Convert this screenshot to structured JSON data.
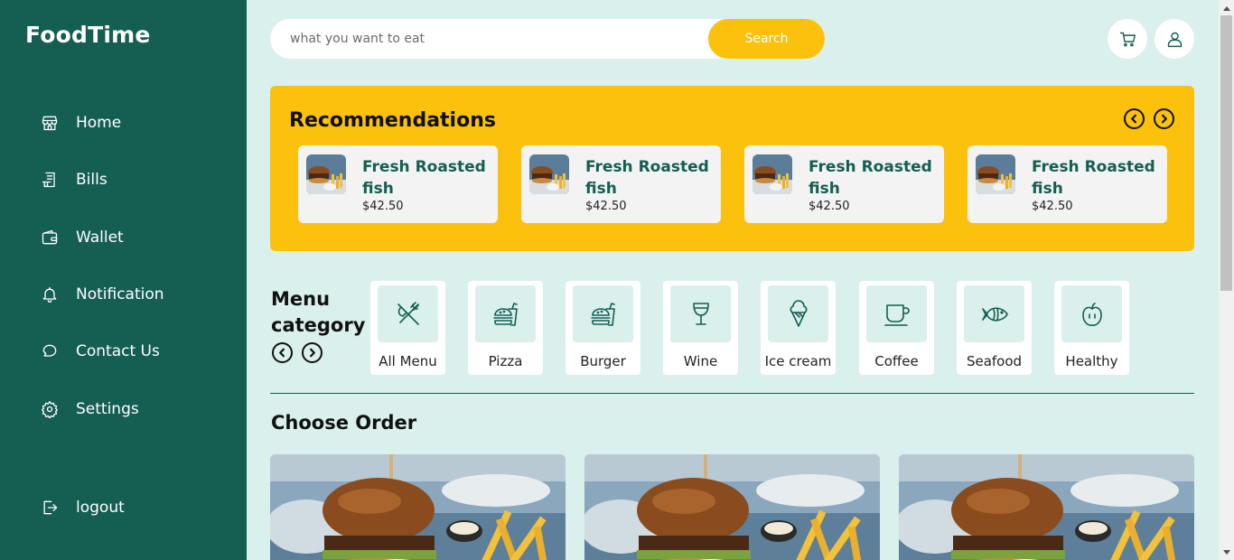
{
  "app": {
    "brand": "FoodTime"
  },
  "sidebar": {
    "items": [
      {
        "label": "Home",
        "icon": "store-icon"
      },
      {
        "label": "Bills",
        "icon": "receipt-icon"
      },
      {
        "label": "Wallet",
        "icon": "wallet-icon"
      },
      {
        "label": "Notification",
        "icon": "bell-icon"
      },
      {
        "label": "Contact Us",
        "icon": "chat-icon"
      },
      {
        "label": "Settings",
        "icon": "gear-icon"
      }
    ],
    "logout": {
      "label": "logout",
      "icon": "logout-icon"
    }
  },
  "search": {
    "placeholder": "what you want to eat",
    "value": "",
    "button_label": "Search"
  },
  "header": {
    "cart_icon": "cart-icon",
    "profile_icon": "user-icon"
  },
  "recommendations": {
    "title": "Recommendations",
    "items": [
      {
        "name": "Fresh Roasted fish",
        "price": "$42.50"
      },
      {
        "name": "Fresh Roasted fish",
        "price": "$42.50"
      },
      {
        "name": "Fresh Roasted fish",
        "price": "$42.50"
      },
      {
        "name": "Fresh Roasted fish",
        "price": "$42.50"
      }
    ]
  },
  "menu_category": {
    "title": "Menu category",
    "items": [
      {
        "label": "All Menu",
        "icon": "utensils-icon"
      },
      {
        "label": "Pizza",
        "icon": "fastfood-icon"
      },
      {
        "label": "Burger",
        "icon": "fastfood-icon"
      },
      {
        "label": "Wine",
        "icon": "wine-glass-icon"
      },
      {
        "label": "Ice cream",
        "icon": "ice-cream-icon"
      },
      {
        "label": "Coffee",
        "icon": "coffee-cup-icon"
      },
      {
        "label": "Seafood",
        "icon": "fish-icon"
      },
      {
        "label": "Healthy",
        "icon": "apple-icon"
      }
    ]
  },
  "choose_order": {
    "title": "Choose Order",
    "count": 3
  },
  "colors": {
    "sidebar": "#145e52",
    "accent": "#fcc10c",
    "background": "#d9f0ec"
  }
}
